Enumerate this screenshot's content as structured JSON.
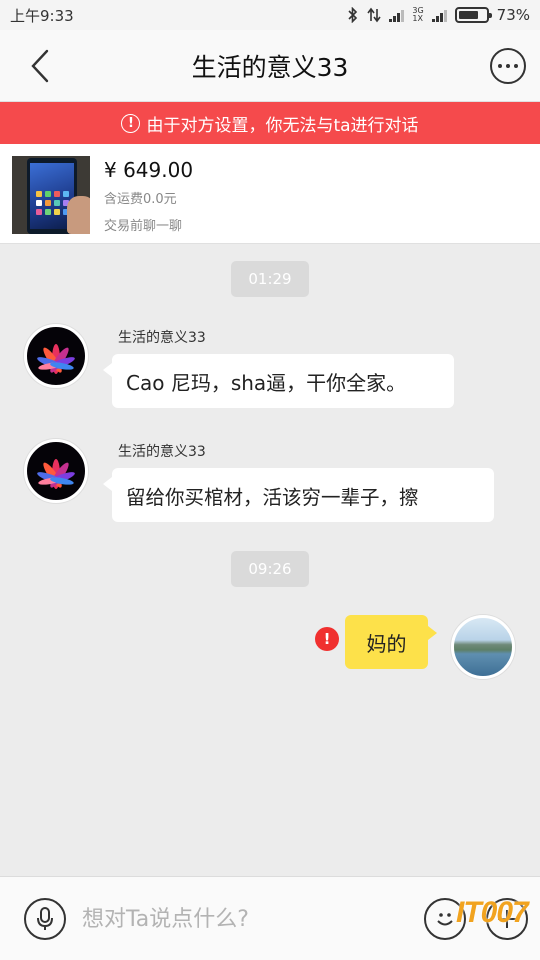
{
  "status_bar": {
    "time": "上午9:33",
    "network_top": "3G",
    "network_bottom": "1X",
    "battery": "73%",
    "battery_level": 0.73
  },
  "header": {
    "title": "生活的意义33"
  },
  "warning_banner": {
    "icon": "!",
    "text": "由于对方设置，你无法与ta进行对话"
  },
  "product": {
    "price": "¥ 649.00",
    "shipping": "含运费0.0元",
    "chat_prompt": "交易前聊一聊"
  },
  "messages": [
    {
      "time": "01:29"
    },
    {
      "sender": "生活的意义33",
      "text": "Cao 尼玛，sha逼，干你全家。"
    },
    {
      "sender": "生活的意义33",
      "text": "留给你买棺材，活该穷一辈子，擦"
    },
    {
      "time": "09:26"
    },
    {
      "text": "妈的",
      "fail_icon": "!"
    }
  ],
  "input_bar": {
    "placeholder": "想对Ta说点什么?",
    "value": ""
  },
  "watermark": "IT007",
  "colors": {
    "warning_red": "#f54a4c",
    "my_bubble": "#fde14a",
    "fail_red": "#f0302f"
  }
}
